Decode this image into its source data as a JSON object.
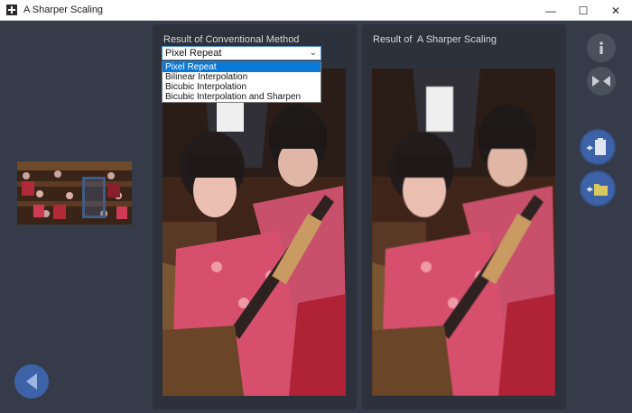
{
  "window": {
    "title": "A Sharper Scaling",
    "minimize_glyph": "—",
    "maximize_glyph": "☐",
    "close_glyph": "✕"
  },
  "left_panel": {
    "label": "Result of Conventional Method"
  },
  "right_panel": {
    "label": "Result of  A Sharper Scaling"
  },
  "method_select": {
    "selected": "Pixel Repeat",
    "options": [
      "Pixel Repeat",
      "Bilinear Interpolation",
      "Bicubic Interpolation",
      "Bicubic Interpolation and Sharpen"
    ]
  },
  "side_buttons": {
    "info": "info-icon",
    "compare": "compare-arrows-icon",
    "copy": "paste-to-clipboard-icon",
    "save": "save-to-folder-icon",
    "back": "back-arrow-icon"
  },
  "colors": {
    "background": "#353b48",
    "panel": "#2c313c",
    "accent_blue": "#3e62a8",
    "selection": "#0a78d7"
  }
}
